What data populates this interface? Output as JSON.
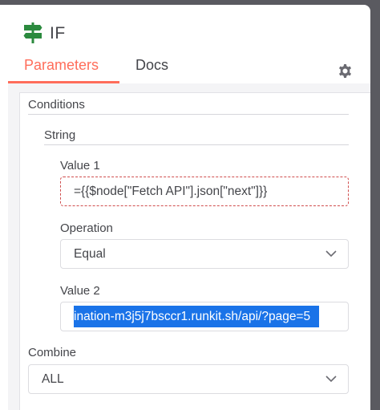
{
  "node": {
    "title": "IF",
    "icon": "signpost-icon"
  },
  "tabs": [
    {
      "label": "Parameters",
      "active": true
    },
    {
      "label": "Docs",
      "active": false
    }
  ],
  "settings_icon": "gear-icon",
  "conditions": {
    "heading": "Conditions",
    "string_heading": "String",
    "value1": {
      "label": "Value 1",
      "value": "={{$node[\"Fetch API\"].json[\"next\"]}}"
    },
    "operation": {
      "label": "Operation",
      "value": "Equal"
    },
    "value2": {
      "label": "Value 2",
      "value": "ination-m3j5j7bsccr1.runkit.sh/api/?page=5"
    }
  },
  "combine": {
    "label": "Combine",
    "value": "ALL"
  },
  "colors": {
    "accent": "#ff6d5a",
    "selection": "#1a73e8",
    "node_icon": "#2b8a3e",
    "expression_border": "#d04e4e"
  }
}
